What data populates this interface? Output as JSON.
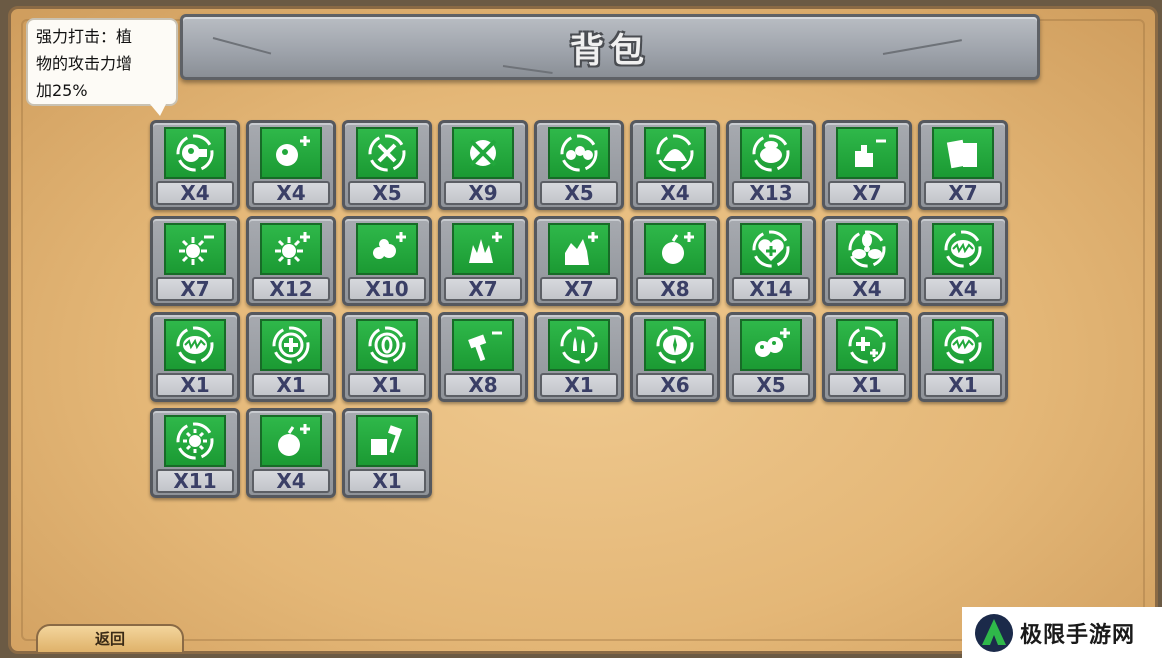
{
  "title": "背包",
  "tooltip": {
    "lines": [
      "强力打击：植",
      "物的攻击力增",
      "加25%"
    ]
  },
  "back_button": {
    "label": "返回"
  },
  "watermark": {
    "text": "极限手游网"
  },
  "colors": {
    "icon_green": "#22a83c",
    "count_text": "#3a3f66",
    "panel": "#e4b777"
  },
  "items": [
    {
      "icon": "peashooter-icon",
      "count": "X4"
    },
    {
      "icon": "pea-plus-icon",
      "count": "X4"
    },
    {
      "icon": "target-icon",
      "count": "X5"
    },
    {
      "icon": "crosshair-icon",
      "count": "X9"
    },
    {
      "icon": "multi-pea-icon",
      "count": "X5"
    },
    {
      "icon": "zombie-head-icon",
      "count": "X4"
    },
    {
      "icon": "zombie-brain-icon",
      "count": "X13"
    },
    {
      "icon": "hand-minus-icon",
      "count": "X7"
    },
    {
      "icon": "book-icon",
      "count": "X7"
    },
    {
      "icon": "sun-minus-icon",
      "count": "X7"
    },
    {
      "icon": "sun-plus-icon",
      "count": "X12"
    },
    {
      "icon": "berries-plus-icon",
      "count": "X10"
    },
    {
      "icon": "spiky-plus-icon",
      "count": "X7"
    },
    {
      "icon": "cactus-plus-icon",
      "count": "X7"
    },
    {
      "icon": "apple-plus-icon",
      "count": "X8"
    },
    {
      "icon": "heart-plus-icon",
      "count": "X14"
    },
    {
      "icon": "fan-icon",
      "count": "X4"
    },
    {
      "icon": "chomper-icon",
      "count": "X4"
    },
    {
      "icon": "chomper-icon",
      "count": "X1"
    },
    {
      "icon": "plus-circle-icon",
      "count": "X1"
    },
    {
      "icon": "zero-circle-icon",
      "count": "X1"
    },
    {
      "icon": "hammer-minus-icon",
      "count": "X8"
    },
    {
      "icon": "drops-icon",
      "count": "X1"
    },
    {
      "icon": "mouth-icon",
      "count": "X6"
    },
    {
      "icon": "pea-pair-plus-icon",
      "count": "X5"
    },
    {
      "icon": "double-plus-icon",
      "count": "X1"
    },
    {
      "icon": "chomper-icon",
      "count": "X1"
    },
    {
      "icon": "sunburst-icon",
      "count": "X11"
    },
    {
      "icon": "apple-plus-icon",
      "count": "X4"
    },
    {
      "icon": "gift-hammer-icon",
      "count": "X1"
    }
  ]
}
